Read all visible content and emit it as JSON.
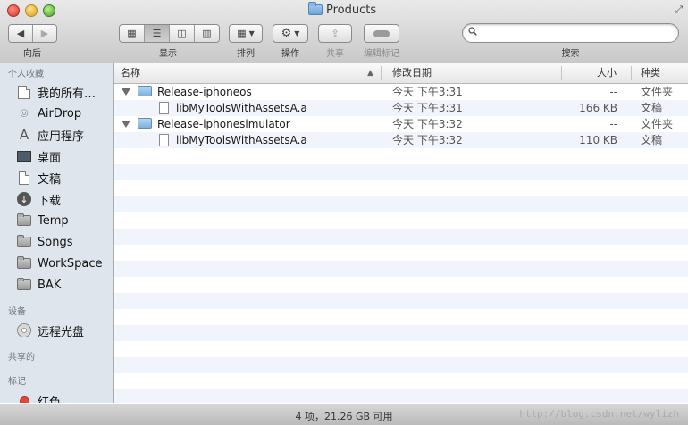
{
  "window": {
    "title": "Products"
  },
  "toolbar": {
    "back_label": "向后",
    "view_label": "显示",
    "arrange_label": "排列",
    "action_label": "操作",
    "share_label": "共享",
    "tags_label": "编辑标记",
    "search_label": "搜索",
    "search_value": ""
  },
  "sidebar": {
    "favorites_header": "个人收藏",
    "favorites": [
      {
        "label": "我的所有…",
        "icon": "all-files-icon"
      },
      {
        "label": "AirDrop",
        "icon": "airdrop-icon"
      },
      {
        "label": "应用程序",
        "icon": "applications-icon"
      },
      {
        "label": "桌面",
        "icon": "desktop-icon"
      },
      {
        "label": "文稿",
        "icon": "documents-icon"
      },
      {
        "label": "下载",
        "icon": "downloads-icon"
      },
      {
        "label": "Temp",
        "icon": "folder-icon"
      },
      {
        "label": "Songs",
        "icon": "folder-icon"
      },
      {
        "label": "WorkSpace",
        "icon": "folder-icon"
      },
      {
        "label": "BAK",
        "icon": "folder-icon"
      }
    ],
    "devices_header": "设备",
    "devices": [
      {
        "label": "远程光盘",
        "icon": "disc-icon"
      }
    ],
    "shared_header": "共享的",
    "tags_header": "标记",
    "tags": [
      {
        "label": "红色",
        "color": "#e2453c"
      }
    ]
  },
  "columns": {
    "name": "名称",
    "modified": "修改日期",
    "size": "大小",
    "kind": "种类"
  },
  "files": [
    {
      "name": "Release-iphoneos",
      "modified": "今天 下午3:31",
      "size": "--",
      "kind": "文件夹",
      "type": "folder",
      "level": 0
    },
    {
      "name": "libMyToolsWithAssetsA.a",
      "modified": "今天 下午3:31",
      "size": "166 KB",
      "kind": "文稿",
      "type": "file",
      "level": 1
    },
    {
      "name": "Release-iphonesimulator",
      "modified": "今天 下午3:32",
      "size": "--",
      "kind": "文件夹",
      "type": "folder",
      "level": 0
    },
    {
      "name": "libMyToolsWithAssetsA.a",
      "modified": "今天 下午3:32",
      "size": "110 KB",
      "kind": "文稿",
      "type": "file",
      "level": 1
    }
  ],
  "status": {
    "text": "4 项，21.26 GB 可用",
    "watermark": "http://blog.csdn.net/wylizh"
  }
}
